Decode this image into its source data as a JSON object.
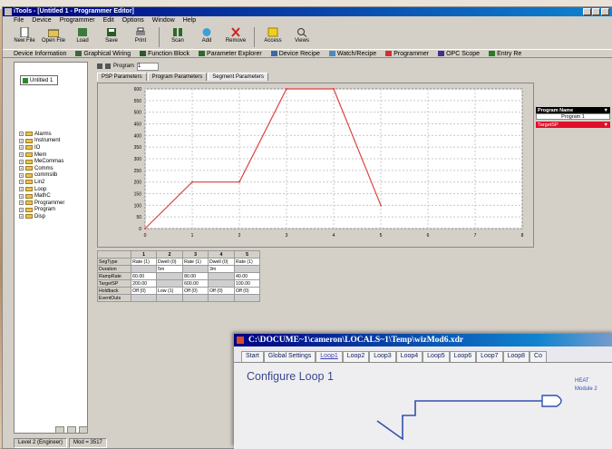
{
  "window": {
    "title": "iTools - [Untitled 1 - Programmer Editor]",
    "menu": [
      "File",
      "Device",
      "Programmer",
      "Edit",
      "Options",
      "Window",
      "Help"
    ]
  },
  "toolbar": {
    "buttons": [
      {
        "label": "New File",
        "icon": "new-file-icon"
      },
      {
        "label": "Open File",
        "icon": "open-file-icon"
      },
      {
        "label": "Load",
        "icon": "load-icon"
      },
      {
        "label": "Save",
        "icon": "save-icon"
      },
      {
        "label": "Print",
        "icon": "print-icon"
      },
      {
        "label": "Scan",
        "icon": "scan-icon"
      },
      {
        "label": "Add",
        "icon": "add-icon"
      },
      {
        "label": "Remove",
        "icon": "remove-icon"
      },
      {
        "label": "Access",
        "icon": "access-icon"
      },
      {
        "label": "Views",
        "icon": "views-icon"
      }
    ]
  },
  "view_tabs": [
    "Device Information",
    "Graphical Wiring",
    "Function Block",
    "Parameter Explorer",
    "Device Recipe",
    "Watch/Recipe",
    "Programmer",
    "OPC Scope",
    "Entry Re"
  ],
  "tree": {
    "root": "Untitled 1",
    "items": [
      "Alarms",
      "Instrument",
      "IO",
      "Mem",
      "MeCommas",
      "Comms",
      "commslib",
      "Lin2",
      "Loop",
      "MathC",
      "Programmer",
      "Program",
      "Disp"
    ]
  },
  "status": [
    "Level 2 (Engineer)",
    "Mod = 3517"
  ],
  "editor": {
    "program_label": "Program",
    "program_value": "1",
    "tabs": [
      "PSP Parameters",
      "Program Parameters",
      "Segment Parameters"
    ],
    "active_tab": 2
  },
  "chart_data": {
    "type": "line",
    "x": [
      0,
      1,
      2,
      3,
      4,
      5
    ],
    "series": [
      {
        "values": [
          0,
          200,
          200,
          600,
          600,
          100
        ],
        "color": "#e04040"
      }
    ],
    "xticks": [
      "0",
      "1",
      "2",
      "3",
      "4",
      "5",
      "6",
      "7",
      "8"
    ],
    "yticks": [
      "0",
      "50",
      "100",
      "150",
      "200",
      "250",
      "300",
      "350",
      "400",
      "450",
      "500",
      "550",
      "600"
    ],
    "xlim": [
      0,
      8
    ],
    "ylim": [
      0,
      600
    ],
    "grid": true,
    "line_color": "#e04040"
  },
  "segment_table": {
    "columns": [
      "1",
      "2",
      "3",
      "4",
      "5"
    ],
    "rows": [
      {
        "label": "SegType",
        "cells": [
          "Rate (1)",
          "Dwell (0)",
          "Rate (1)",
          "Dwell (0)",
          "Rate (1)"
        ]
      },
      {
        "label": "Duration",
        "cells": [
          "",
          "5m",
          "",
          "3m",
          ""
        ]
      },
      {
        "label": "RampRate",
        "cells": [
          "60.00",
          "",
          "80.00",
          "",
          "40.00"
        ]
      },
      {
        "label": "TargetSP",
        "cells": [
          "200.00",
          "",
          "600.00",
          "",
          "100.00"
        ]
      },
      {
        "label": "Holdback",
        "cells": [
          "Off (0)",
          "Low (1)",
          "Off (0)",
          "Off (0)",
          "Off (0)"
        ]
      },
      {
        "label": "EventOuts",
        "cells": [
          "",
          "",
          "",
          "",
          ""
        ]
      }
    ]
  },
  "legend": {
    "head": "Program Name",
    "row": "Program 1",
    "target": "TargetSP",
    "target_color": "#e0102a"
  },
  "popup": {
    "title": "C:\\DOCUME~1\\cameron\\LOCALS~1\\Temp\\wizMod6.xdr",
    "tabs": [
      "Start",
      "Global Settings",
      "Loop1",
      "Loop2",
      "Loop3",
      "Loop4",
      "Loop5",
      "Loop6",
      "Loop7",
      "Loop8",
      "Co"
    ],
    "active_tab": "Loop1",
    "heading": "Configure Loop 1",
    "heat_label": "HEAT",
    "module_label": "Module 2"
  }
}
